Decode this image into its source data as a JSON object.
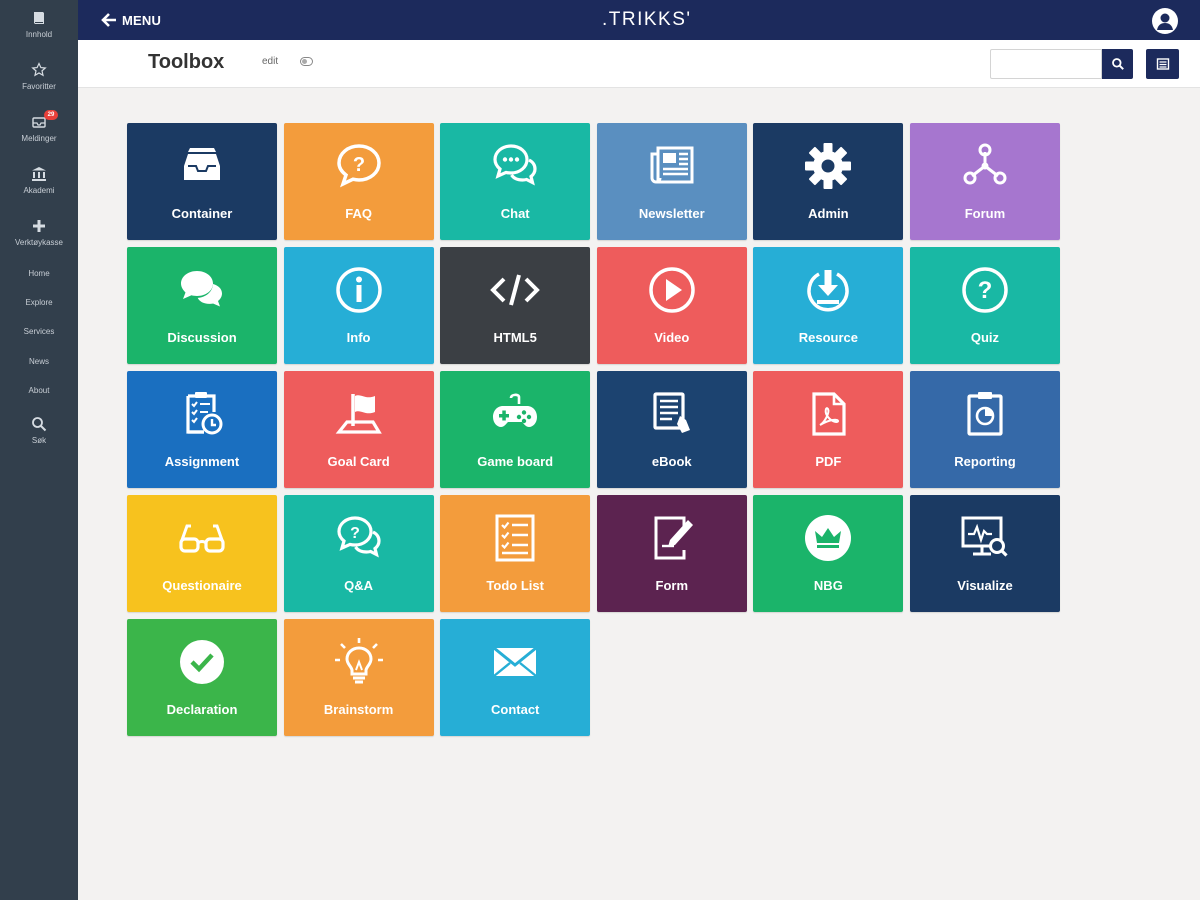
{
  "sidebar": {
    "icon_items": [
      {
        "label": "Innhold",
        "icon": "book-icon"
      },
      {
        "label": "Favoritter",
        "icon": "star-icon"
      },
      {
        "label": "Meldinger",
        "icon": "inbox-icon",
        "badge": "29"
      },
      {
        "label": "Akademi",
        "icon": "bank-icon"
      },
      {
        "label": "Verktøykasse",
        "icon": "plus-icon"
      }
    ],
    "text_items": [
      "Home",
      "Explore",
      "Services",
      "News",
      "About"
    ],
    "search": {
      "label": "Søk",
      "icon": "search-icon"
    }
  },
  "topbar": {
    "menu_label": "MENU",
    "logo": ".TRIKKS'",
    "user_icon": "user-icon"
  },
  "subheader": {
    "title": "Toolbox",
    "edit_label": "edit",
    "search_placeholder": ""
  },
  "tiles": [
    {
      "label": "Container",
      "icon": "inbox-tray-icon",
      "color": "#1b3a63"
    },
    {
      "label": "FAQ",
      "icon": "question-bubble-icon",
      "color": "#f39c3c"
    },
    {
      "label": "Chat",
      "icon": "chat-bubbles-icon",
      "color": "#19b8a4"
    },
    {
      "label": "Newsletter",
      "icon": "newspaper-icon",
      "color": "#5a8fc0"
    },
    {
      "label": "Admin",
      "icon": "gear-icon",
      "color": "#1b3a63"
    },
    {
      "label": "Forum",
      "icon": "network-icon",
      "color": "#a676cf"
    },
    {
      "label": "Discussion",
      "icon": "speech-bubbles-icon",
      "color": "#1bb46a"
    },
    {
      "label": "Info",
      "icon": "info-icon",
      "color": "#26aed6"
    },
    {
      "label": "HTML5",
      "icon": "code-icon",
      "color": "#3b3f44"
    },
    {
      "label": "Video",
      "icon": "play-icon",
      "color": "#ee5c5c"
    },
    {
      "label": "Resource",
      "icon": "download-icon",
      "color": "#26aed6"
    },
    {
      "label": "Quiz",
      "icon": "question-circle-icon",
      "color": "#19b8a4"
    },
    {
      "label": "Assignment",
      "icon": "clipboard-clock-icon",
      "color": "#1a6fc0"
    },
    {
      "label": "Goal Card",
      "icon": "flag-icon",
      "color": "#ee5c5c"
    },
    {
      "label": "Game board",
      "icon": "gamepad-icon",
      "color": "#1bb46a"
    },
    {
      "label": "eBook",
      "icon": "ebook-icon",
      "color": "#1c4370"
    },
    {
      "label": "PDF",
      "icon": "pdf-icon",
      "color": "#ee5c5c"
    },
    {
      "label": "Reporting",
      "icon": "report-icon",
      "color": "#3569a8"
    },
    {
      "label": "Questionaire",
      "icon": "glasses-icon",
      "color": "#f7c21e"
    },
    {
      "label": "Q&A",
      "icon": "qa-bubbles-icon",
      "color": "#19b8a4"
    },
    {
      "label": "Todo List",
      "icon": "checklist-icon",
      "color": "#f39c3c"
    },
    {
      "label": "Form",
      "icon": "form-pen-icon",
      "color": "#5c2350"
    },
    {
      "label": "NBG",
      "icon": "crown-icon",
      "color": "#1bb46a"
    },
    {
      "label": "Visualize",
      "icon": "monitor-search-icon",
      "color": "#1b3a63"
    },
    {
      "label": "Declaration",
      "icon": "check-circle-icon",
      "color": "#3bb54a"
    },
    {
      "label": "Brainstorm",
      "icon": "lightbulb-icon",
      "color": "#f39c3c"
    },
    {
      "label": "Contact",
      "icon": "envelope-icon",
      "color": "#26aed6"
    }
  ]
}
